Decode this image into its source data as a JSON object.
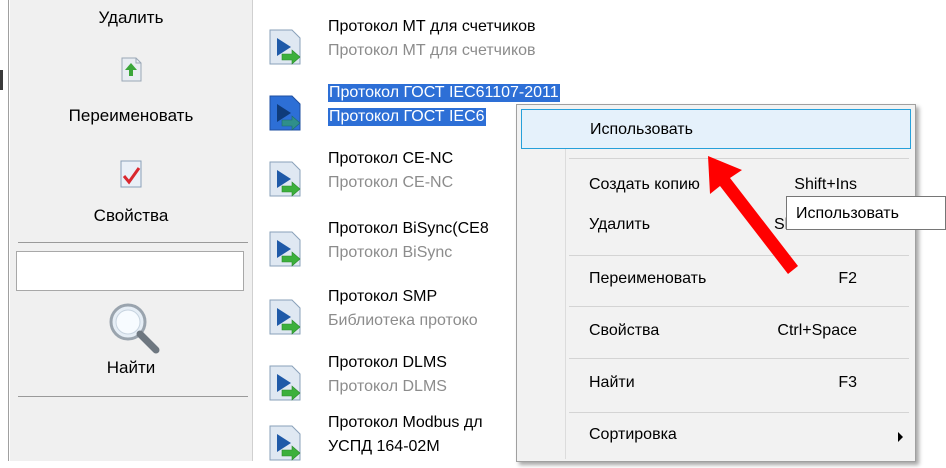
{
  "toolbar": {
    "delete_label": "Удалить",
    "rename_label": "Переименовать",
    "properties_label": "Свойства",
    "search_value": "",
    "find_label": "Найти"
  },
  "list": {
    "items": [
      {
        "title": "Протокол МТ для счетчиков",
        "subtitle": "Протокол МТ для счетчиков"
      },
      {
        "title": "Протокол ГОСТ IEC61107-2011",
        "subtitle": "Протокол ГОСТ IEC6"
      },
      {
        "title": "Протокол CE-NC",
        "subtitle": "Протокол CE-NC"
      },
      {
        "title": "Протокол BiSync(CE8",
        "subtitle": "Протокол BiSync"
      },
      {
        "title": "Протокол SMP",
        "subtitle": "Библиотека протоко"
      },
      {
        "title": "Протокол DLMS",
        "subtitle": "Протокол DLMS"
      },
      {
        "title": "Протокол Modbus дл",
        "subtitle": "УСПД 164-02М"
      }
    ]
  },
  "context_menu": {
    "use": "Использовать",
    "create_copy": "Создать копию",
    "create_copy_shortcut": "Shift+Ins",
    "delete": "Удалить",
    "delete_shortcut": "Sh",
    "rename": "Переименовать",
    "rename_shortcut": "F2",
    "properties": "Свойства",
    "properties_shortcut": "Ctrl+Space",
    "find": "Найти",
    "find_shortcut": "F3",
    "sort": "Сортировка"
  },
  "tooltip": {
    "text": "Использовать"
  },
  "colors": {
    "selection": "#2d6fd6",
    "menu_highlight": "#e5f1fb",
    "menu_highlight_border": "#26a0da",
    "annotation_arrow": "#ff0000"
  }
}
